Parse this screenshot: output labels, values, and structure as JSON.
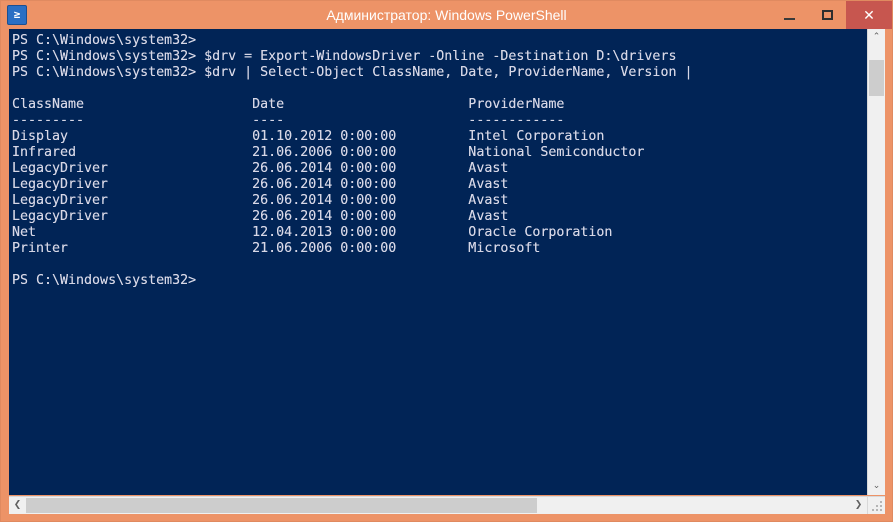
{
  "window": {
    "title": "Администратор: Windows PowerShell",
    "icon": "powershell-icon",
    "icon_glyph": "≥",
    "frame_color": "#ed9367",
    "console_bg": "#012456",
    "console_fg": "#d7d7e6",
    "close_button_color": "#c7564f"
  },
  "titlebar_buttons": {
    "minimize_label": "",
    "maximize_label": "",
    "close_label": "✕"
  },
  "scrollbars": {
    "v_up_label": "⌃",
    "v_down_label": "⌄",
    "h_left_label": "❮",
    "h_right_label": "❯"
  },
  "console": {
    "prompt": "PS C:\\Windows\\system32>",
    "lines": [
      "PS C:\\Windows\\system32>",
      "PS C:\\Windows\\system32> $drv = Export-WindowsDriver -Online -Destination D:\\drivers",
      "PS C:\\Windows\\system32> $drv | Select-Object ClassName, Date, ProviderName, Version |",
      "",
      "ClassName                     Date                       ProviderName",
      "---------                     ----                       ------------",
      "Display                       01.10.2012 0:00:00         Intel Corporation",
      "Infrared                      21.06.2006 0:00:00         National Semiconductor",
      "LegacyDriver                  26.06.2014 0:00:00         Avast",
      "LegacyDriver                  26.06.2014 0:00:00         Avast",
      "LegacyDriver                  26.06.2014 0:00:00         Avast",
      "LegacyDriver                  26.06.2014 0:00:00         Avast",
      "Net                           12.04.2013 0:00:00         Oracle Corporation",
      "Printer                       21.06.2006 0:00:00         Microsoft",
      "",
      "PS C:\\Windows\\system32>"
    ],
    "commands": [
      "$drv = Export-WindowsDriver -Online -Destination D:\\drivers",
      "$drv | Select-Object ClassName, Date, ProviderName, Version |"
    ],
    "table": {
      "headers": [
        "ClassName",
        "Date",
        "ProviderName"
      ],
      "underlines": [
        "---------",
        "----",
        "------------"
      ],
      "rows": [
        [
          "Display",
          "01.10.2012 0:00:00",
          "Intel Corporation"
        ],
        [
          "Infrared",
          "21.06.2006 0:00:00",
          "National Semiconductor"
        ],
        [
          "LegacyDriver",
          "26.06.2014 0:00:00",
          "Avast"
        ],
        [
          "LegacyDriver",
          "26.06.2014 0:00:00",
          "Avast"
        ],
        [
          "LegacyDriver",
          "26.06.2014 0:00:00",
          "Avast"
        ],
        [
          "LegacyDriver",
          "26.06.2014 0:00:00",
          "Avast"
        ],
        [
          "Net",
          "12.04.2013 0:00:00",
          "Oracle Corporation"
        ],
        [
          "Printer",
          "21.06.2006 0:00:00",
          "Microsoft"
        ]
      ]
    }
  }
}
